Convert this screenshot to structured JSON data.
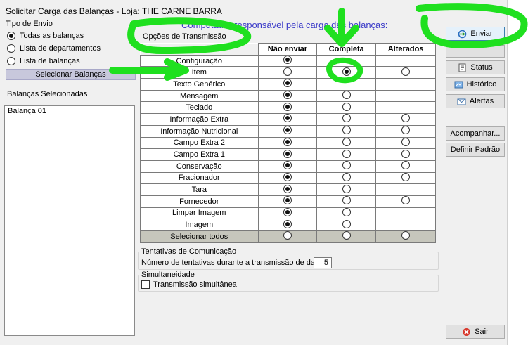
{
  "window": {
    "title": "Solicitar Carga das Balanças - Loja: THE CARNE BARRA"
  },
  "tipo_envio": {
    "label": "Tipo de Envio",
    "options": [
      {
        "label": "Todas as balanças",
        "checked": true
      },
      {
        "label": "Lista de departamentos",
        "checked": false
      },
      {
        "label": "Lista de balanças",
        "checked": false
      }
    ],
    "select_button": "Selecionar Balanças"
  },
  "balancas_selecionadas": {
    "label": "Balanças Selecionadas",
    "items": [
      "Balança 01"
    ]
  },
  "panel_heading": "Computador responsável pela carga das balanças:",
  "opcoes": {
    "label": "Opções de Transmissão",
    "columns": [
      "Não enviar",
      "Completa",
      "Alterados"
    ],
    "rows": [
      {
        "name": "Configuração",
        "cells": [
          "checked",
          "none",
          "none"
        ]
      },
      {
        "name": "Item",
        "cells": [
          "empty",
          "checked",
          "empty"
        ]
      },
      {
        "name": "Texto Genérico",
        "cells": [
          "checked",
          "none",
          "none"
        ]
      },
      {
        "name": "Mensagem",
        "cells": [
          "checked",
          "empty",
          "none"
        ]
      },
      {
        "name": "Teclado",
        "cells": [
          "checked",
          "empty",
          "none"
        ]
      },
      {
        "name": "Informação Extra",
        "cells": [
          "checked",
          "empty",
          "empty"
        ]
      },
      {
        "name": "Informação Nutricional",
        "cells": [
          "checked",
          "empty",
          "empty"
        ]
      },
      {
        "name": "Campo Extra 2",
        "cells": [
          "checked",
          "empty",
          "empty"
        ]
      },
      {
        "name": "Campo Extra 1",
        "cells": [
          "checked",
          "empty",
          "empty"
        ]
      },
      {
        "name": "Conservação",
        "cells": [
          "checked",
          "empty",
          "empty"
        ]
      },
      {
        "name": "Fracionador",
        "cells": [
          "checked",
          "empty",
          "empty"
        ]
      },
      {
        "name": "Tara",
        "cells": [
          "checked",
          "empty",
          "none"
        ]
      },
      {
        "name": "Fornecedor",
        "cells": [
          "checked",
          "empty",
          "empty"
        ]
      },
      {
        "name": "Limpar Imagem",
        "cells": [
          "checked",
          "empty",
          "none"
        ]
      },
      {
        "name": "Imagem",
        "cells": [
          "checked",
          "empty",
          "none"
        ]
      }
    ],
    "footer": {
      "name": "Selecionar todos",
      "cells": [
        "empty",
        "empty",
        "empty"
      ]
    }
  },
  "tentativas": {
    "label": "Tentativas de Comunicação",
    "field_label": "Número de tentativas durante a transmissão de dados",
    "value": "5"
  },
  "simultaneidade": {
    "label": "Simultaneidade",
    "checkbox_label": "Transmissão simultânea",
    "checked": false
  },
  "buttons": {
    "enviar": "Enviar",
    "status": "Status",
    "historico": "Histórico",
    "alertas": "Alertas",
    "acompanhar": "Acompanhar...",
    "definir_padrao": "Definir Padrão",
    "sair": "Sair"
  },
  "colors": {
    "annotation": "#1fe01f",
    "heading": "#3a3ac8",
    "footer_row": "#c6c6bc",
    "select_button": "#c8c8dc"
  }
}
